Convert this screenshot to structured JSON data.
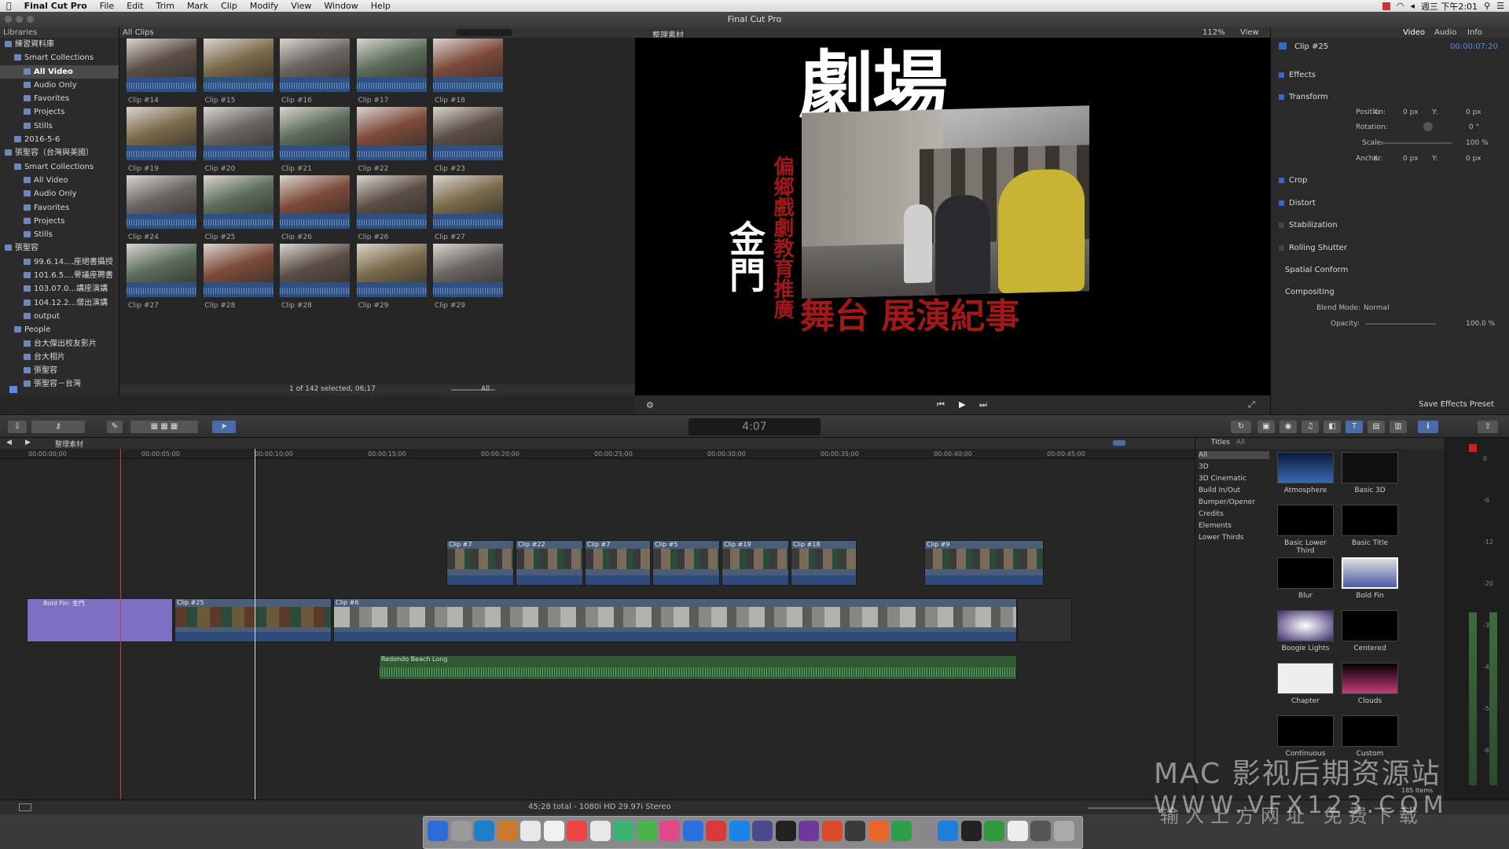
{
  "menubar": {
    "app": "Final Cut Pro",
    "items": [
      "File",
      "Edit",
      "Trim",
      "Mark",
      "Clip",
      "Modify",
      "View",
      "Window",
      "Help"
    ],
    "clock": "週三 下午2:01"
  },
  "window": {
    "title": "Final Cut Pro"
  },
  "libraries": {
    "header": "Libraries",
    "rows": [
      {
        "label": "練習資料庫",
        "level": 0
      },
      {
        "label": "Smart Collections",
        "level": 1
      },
      {
        "label": "All Video",
        "level": 2,
        "selected": true
      },
      {
        "label": "Audio Only",
        "level": 2
      },
      {
        "label": "Favorites",
        "level": 2
      },
      {
        "label": "Projects",
        "level": 2
      },
      {
        "label": "Stills",
        "level": 2
      },
      {
        "label": "2016-5-6",
        "level": 1
      },
      {
        "label": "張聖容（台灣與美國）",
        "level": 0
      },
      {
        "label": "Smart Collections",
        "level": 1
      },
      {
        "label": "All Video",
        "level": 2
      },
      {
        "label": "Audio Only",
        "level": 2
      },
      {
        "label": "Favorites",
        "level": 2
      },
      {
        "label": "Projects",
        "level": 2
      },
      {
        "label": "Stills",
        "level": 2
      },
      {
        "label": "張聖容",
        "level": 0
      },
      {
        "label": "99.6.14....座絕書攝授",
        "level": 2
      },
      {
        "label": "101.6.5....譽議座聘書",
        "level": 2
      },
      {
        "label": "103.07.0...講座演講",
        "level": 2
      },
      {
        "label": "104.12.2...僧出演講",
        "level": 2
      },
      {
        "label": "output",
        "level": 2
      },
      {
        "label": "People",
        "level": 1
      },
      {
        "label": "台大傑出校友影片",
        "level": 2
      },
      {
        "label": "台大相片",
        "level": 2
      },
      {
        "label": "張聖容",
        "level": 2
      },
      {
        "label": "張聖容－台灣",
        "level": 2
      }
    ]
  },
  "browser": {
    "filter": "All Clips",
    "clips": [
      "Clip #14",
      "Clip #15",
      "Clip #16",
      "Clip #17",
      "Clip #18",
      "Clip #19",
      "Clip #20",
      "Clip #21",
      "Clip #22",
      "Clip #23",
      "Clip #24",
      "Clip #25",
      "Clip #26",
      "Clip #26",
      "Clip #27",
      "Clip #27",
      "Clip #28",
      "Clip #28",
      "Clip #29",
      "Clip #29"
    ],
    "selection_status": "1 of 142 selected, 06;17",
    "show": "All"
  },
  "viewer": {
    "event_name": "整理素材",
    "zoom": "112%",
    "view_menu": "View",
    "title_big": "劇場",
    "title_left": "金門",
    "title_vertical": "偏鄉戲劇教育推廣",
    "title_bottom": "舞台 展演紀事",
    "timecode": "4:07"
  },
  "inspector": {
    "tabs": [
      "Video",
      "Audio",
      "Info"
    ],
    "clip_name": "Clip #25",
    "clip_duration": "00:00:07:20",
    "sections": {
      "effects": "Effects",
      "transform": "Transform",
      "crop": "Crop",
      "distort": "Distort",
      "stabilization": "Stabilization",
      "rolling": "Rolling Shutter",
      "spatial": "Spatial Conform",
      "compositing": "Compositing"
    },
    "fields": {
      "position_label": "Position:",
      "rotation_label": "Rotation:",
      "scale_label": "Scale:",
      "anchor_label": "Anchor:",
      "x": "X:",
      "y": "Y:",
      "px0": "0 px",
      "deg0": "0 °",
      "scale_val": "100 %",
      "blend_label": "Blend Mode:",
      "blend_val": "Normal",
      "opacity_label": "Opacity:",
      "opacity_val": "100.0 %"
    },
    "save_preset": "Save Effects Preset"
  },
  "timeline": {
    "project": "整理素材",
    "ruler": [
      "00:00:00;00",
      "00:00:05;00",
      "00:00:10;00",
      "00:00:15;00",
      "00:00:20;00",
      "00:00:25;00",
      "00:00:30;00",
      "00:00:35;00",
      "00:00:40;00",
      "00:00:45;00"
    ],
    "connected_clips": [
      "Clip #7",
      "Clip #22",
      "Clip #7",
      "Clip #5",
      "Clip #19",
      "Clip #18",
      "Clip #9"
    ],
    "title_clip": "Bold Fin: 金門",
    "main_clips": [
      "Clip #25",
      "Clip #6"
    ],
    "audio_clip": "Redondo Beach Long",
    "status": "45;28 total - 1080i HD 29.97i Stereo"
  },
  "titles_browser": {
    "header": "Titles",
    "filter": "All",
    "categories": [
      "All",
      "3D",
      "3D Cinematic",
      "Build In/Out",
      "Bumper/Opener",
      "Credits",
      "Elements",
      "Lower Thirds"
    ],
    "items": [
      "Atmosphere",
      "Basic 3D",
      "Basic Lower Third",
      "Basic Title",
      "Blur",
      "Bold Fin",
      "Boogie Lights",
      "Centered",
      "Chapter",
      "Clouds",
      "Continuous",
      "Custom"
    ],
    "count": "185 Items"
  },
  "meters": {
    "labels": [
      "0",
      "-6",
      "-12",
      "-20",
      "-30",
      "-40",
      "-50",
      "-60"
    ]
  },
  "watermark": {
    "line1": "MAC 影视后期资源站",
    "line2": "WWW.VFX123.COM",
    "line3": "输入上方网址 免费下载"
  }
}
